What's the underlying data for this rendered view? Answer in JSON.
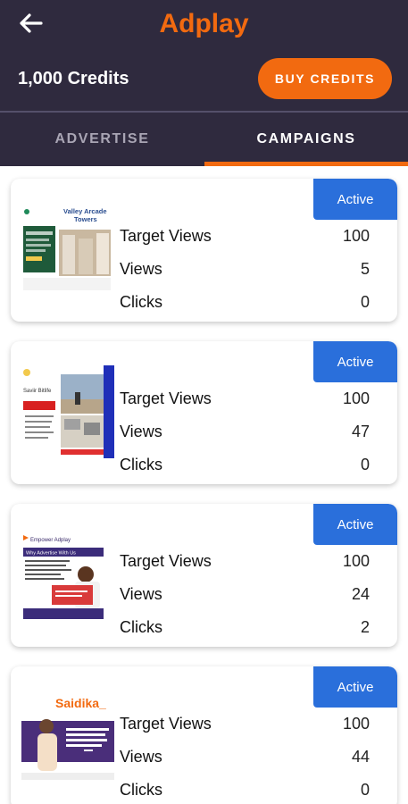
{
  "header": {
    "title": "Adplay",
    "back_icon": "arrow-left-icon",
    "credits": "1,000 Credits",
    "buy_label": "BUY CREDITS"
  },
  "tabs": [
    {
      "label": "ADVERTISE",
      "active": false
    },
    {
      "label": "CAMPAIGNS",
      "active": true
    }
  ],
  "colors": {
    "header_bg": "#2f2a3e",
    "accent": "#f26a10",
    "status_blue": "#2a6fdb"
  },
  "campaigns": [
    {
      "status": "Active",
      "thumb_text": [
        "Valley Arcade",
        "Towers"
      ],
      "stats": [
        {
          "label": "Target Views",
          "value": "100"
        },
        {
          "label": "Views",
          "value": "5"
        },
        {
          "label": "Clicks",
          "value": "0"
        }
      ]
    },
    {
      "status": "Active",
      "thumb_text": [
        "Saviir Bitlife"
      ],
      "stats": [
        {
          "label": "Target Views",
          "value": "100"
        },
        {
          "label": "Views",
          "value": "47"
        },
        {
          "label": "Clicks",
          "value": "0"
        }
      ]
    },
    {
      "status": "Active",
      "thumb_text": [
        "Empower Adplay",
        "Why Advertise With Us"
      ],
      "stats": [
        {
          "label": "Target Views",
          "value": "100"
        },
        {
          "label": "Views",
          "value": "24"
        },
        {
          "label": "Clicks",
          "value": "2"
        }
      ]
    },
    {
      "status": "Active",
      "thumb_text": [
        "Saidika_"
      ],
      "stats": [
        {
          "label": "Target Views",
          "value": "100"
        },
        {
          "label": "Views",
          "value": "44"
        },
        {
          "label": "Clicks",
          "value": "0"
        }
      ]
    }
  ]
}
